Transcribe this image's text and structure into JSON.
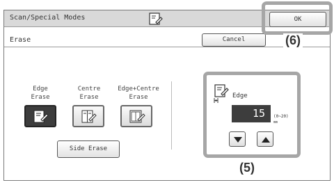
{
  "header": {
    "title": "Scan/Special Modes",
    "mode_icon": "erase-document-icon",
    "ok_label": "OK"
  },
  "subheader": {
    "title": "Erase",
    "cancel_label": "Cancel"
  },
  "callouts": {
    "ok": "(6)",
    "edge_setting": "(5)"
  },
  "modes": [
    {
      "label": "Edge\nErase",
      "icon": "edge-erase-icon",
      "selected": true
    },
    {
      "label": "Centre\nErase",
      "icon": "centre-erase-icon",
      "selected": false
    },
    {
      "label": "Edge+Centre\nErase",
      "icon": "edge-centre-erase-icon",
      "selected": false
    }
  ],
  "side_erase_label": "Side Erase",
  "edge_setting": {
    "label": "Edge",
    "icon": "edge-width-icon",
    "value": "15",
    "range": "(0~20)",
    "unit": "mm",
    "decrease_icon": "triangle-down-icon",
    "increase_icon": "triangle-up-icon"
  },
  "colors": {
    "selected": "#3d3d3d",
    "callout_border": "#a6a6a6",
    "header_bg": "#d9d9d9"
  }
}
